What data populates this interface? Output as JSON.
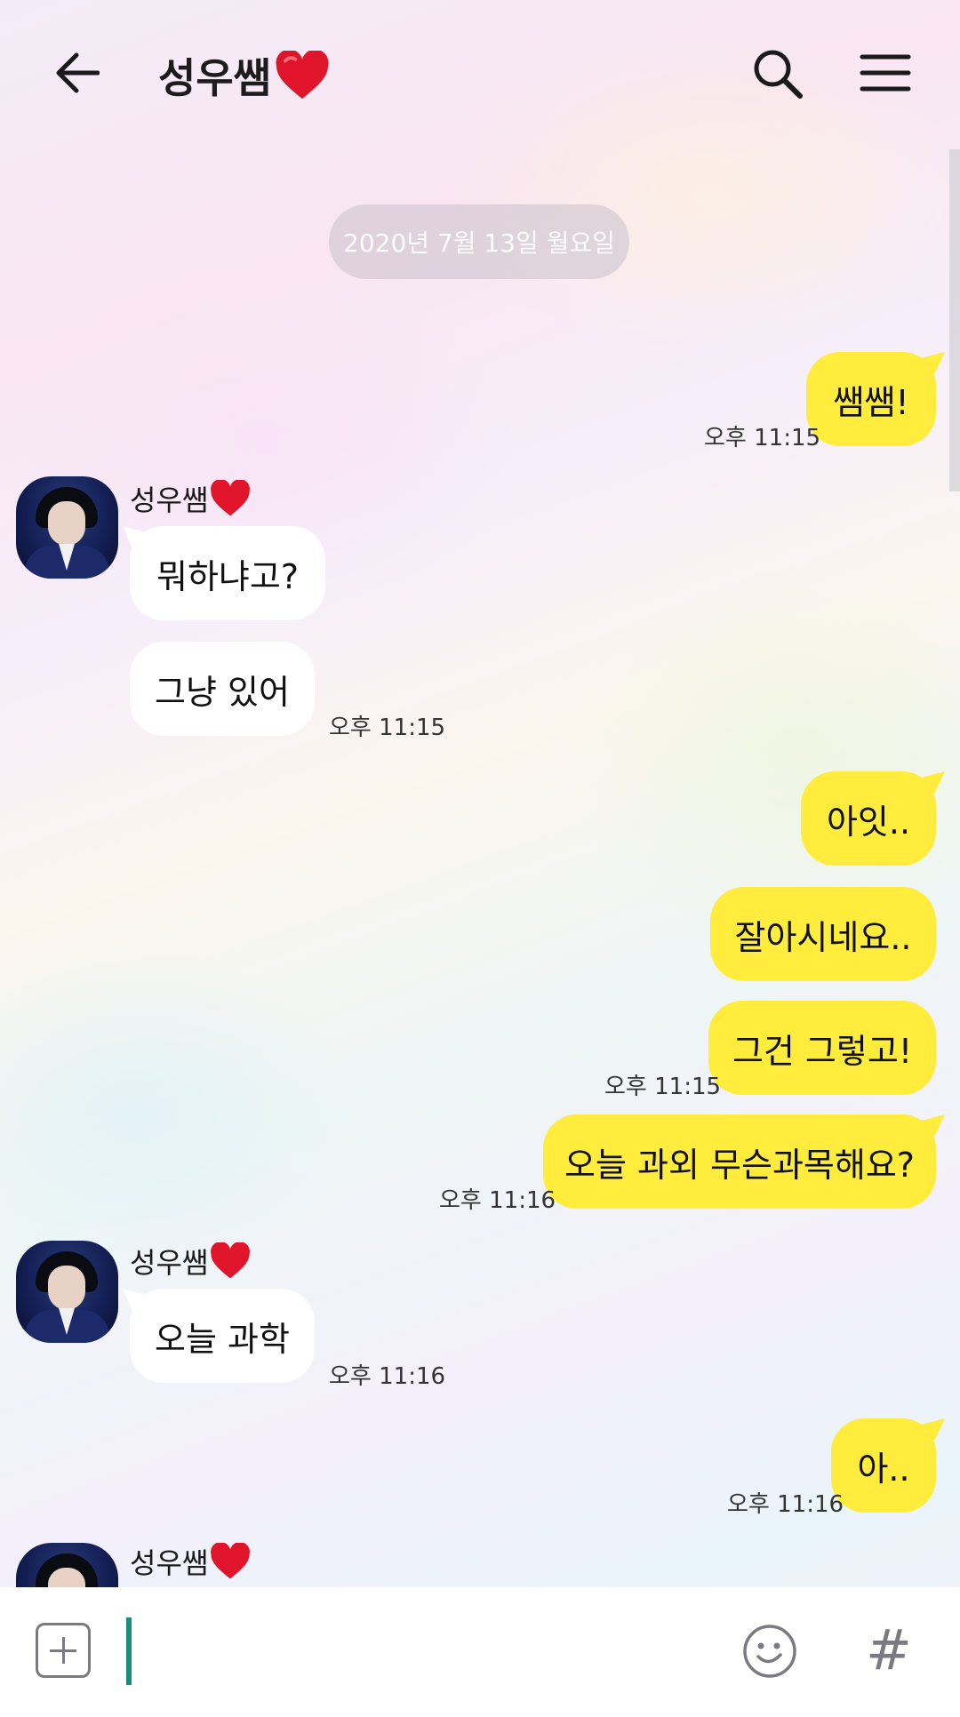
{
  "header": {
    "back_icon": "arrow-left-icon",
    "title": "성우쌤",
    "title_emoji": "heart-icon",
    "search_icon": "search-icon",
    "menu_icon": "hamburger-menu-icon"
  },
  "date_divider": "2020년 7월 13일 월요일",
  "sender": {
    "name": "성우쌤"
  },
  "messages": [
    {
      "direction": "out",
      "text": "쌤쌤!",
      "time": "오후 11:15"
    },
    {
      "direction": "in",
      "text": "뭐하냐고?",
      "time": ""
    },
    {
      "direction": "in",
      "text": "그냥 있어",
      "time": "오후 11:15"
    },
    {
      "direction": "out",
      "text": "아잇..",
      "time": ""
    },
    {
      "direction": "out",
      "text": "잘아시네요..",
      "time": ""
    },
    {
      "direction": "out",
      "text": "그건 그렇고!",
      "time": "오후 11:15"
    },
    {
      "direction": "out",
      "text": "오늘 과외 무슨과목해요?",
      "time": "오후 11:16"
    },
    {
      "direction": "in",
      "text": "오늘 과학",
      "time": "오후 11:16"
    },
    {
      "direction": "out",
      "text": "아..",
      "time": "오후 11:16"
    }
  ],
  "composer": {
    "input_value": "",
    "plus_icon": "plus-icon",
    "emoji_icon": "smiley-icon",
    "hashtag_icon": "hashtag-icon",
    "hashtag_glyph": "#"
  },
  "colors": {
    "outgoing_bubble": "#ffec3c",
    "incoming_bubble": "#ffffff",
    "caret": "#1a8c7a",
    "heart": "#e0142a"
  }
}
